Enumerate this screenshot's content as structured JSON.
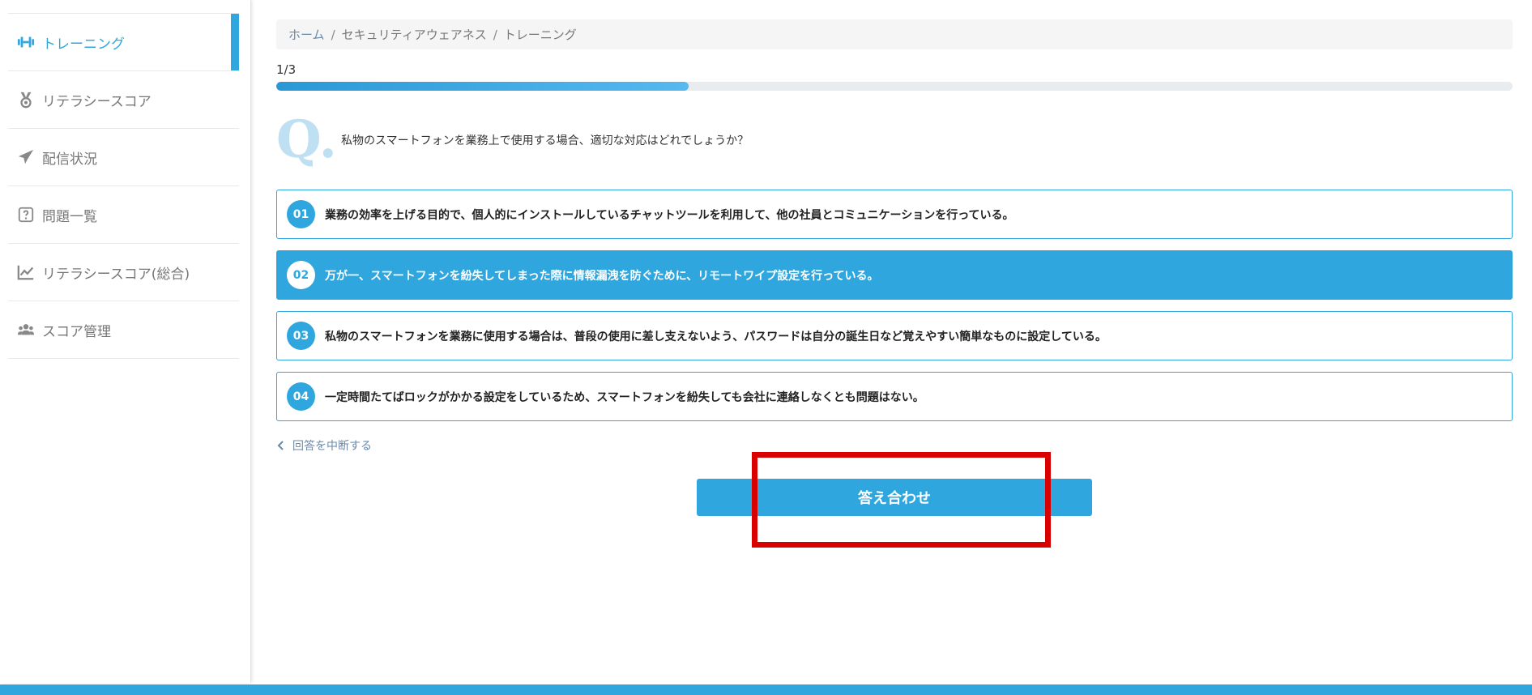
{
  "sidebar": {
    "items": [
      {
        "label": "トレーニング",
        "icon": "dumbbell-icon",
        "active": true
      },
      {
        "label": "リテラシースコア",
        "icon": "medal-icon",
        "active": false
      },
      {
        "label": "配信状況",
        "icon": "paper-plane-icon",
        "active": false
      },
      {
        "label": "問題一覧",
        "icon": "question-square-icon",
        "active": false
      },
      {
        "label": "リテラシースコア(総合)",
        "icon": "line-chart-icon",
        "active": false
      },
      {
        "label": "スコア管理",
        "icon": "users-icon",
        "active": false
      }
    ]
  },
  "breadcrumb": {
    "home": "ホーム",
    "section": "セキュリティアウェアネス",
    "current": "トレーニング",
    "separator": "/"
  },
  "progress": {
    "label": "1/3",
    "fraction": 0.3333
  },
  "question": {
    "mark": "Q.",
    "text": "私物のスマートフォンを業務上で使用する場合、適切な対応はどれでしょうか？"
  },
  "choices": [
    {
      "num": "01",
      "text": "業務の効率を上げる目的で、個人的にインストールしているチャットツールを利用して、他の社員とコミュニケーションを行っている。",
      "selected": false
    },
    {
      "num": "02",
      "text": "万が一、スマートフォンを紛失してしまった際に情報漏洩を防ぐために、リモートワイプ設定を行っている。",
      "selected": true
    },
    {
      "num": "03",
      "text": "私物のスマートフォンを業務に使用する場合は、普段の使用に差し支えないよう、パスワードは自分の誕生日など覚えやすい簡単なものに設定している。",
      "selected": false
    },
    {
      "num": "04",
      "text": "一定時間たてばロックがかかる設定をしているため、スマートフォンを紛失しても会社に連絡しなくとも問題はない。",
      "selected": false
    }
  ],
  "back_link": {
    "label": "回答を中断する"
  },
  "submit": {
    "label": "答え合わせ"
  },
  "colors": {
    "accent": "#2fa7de",
    "highlight": "#d90000"
  }
}
